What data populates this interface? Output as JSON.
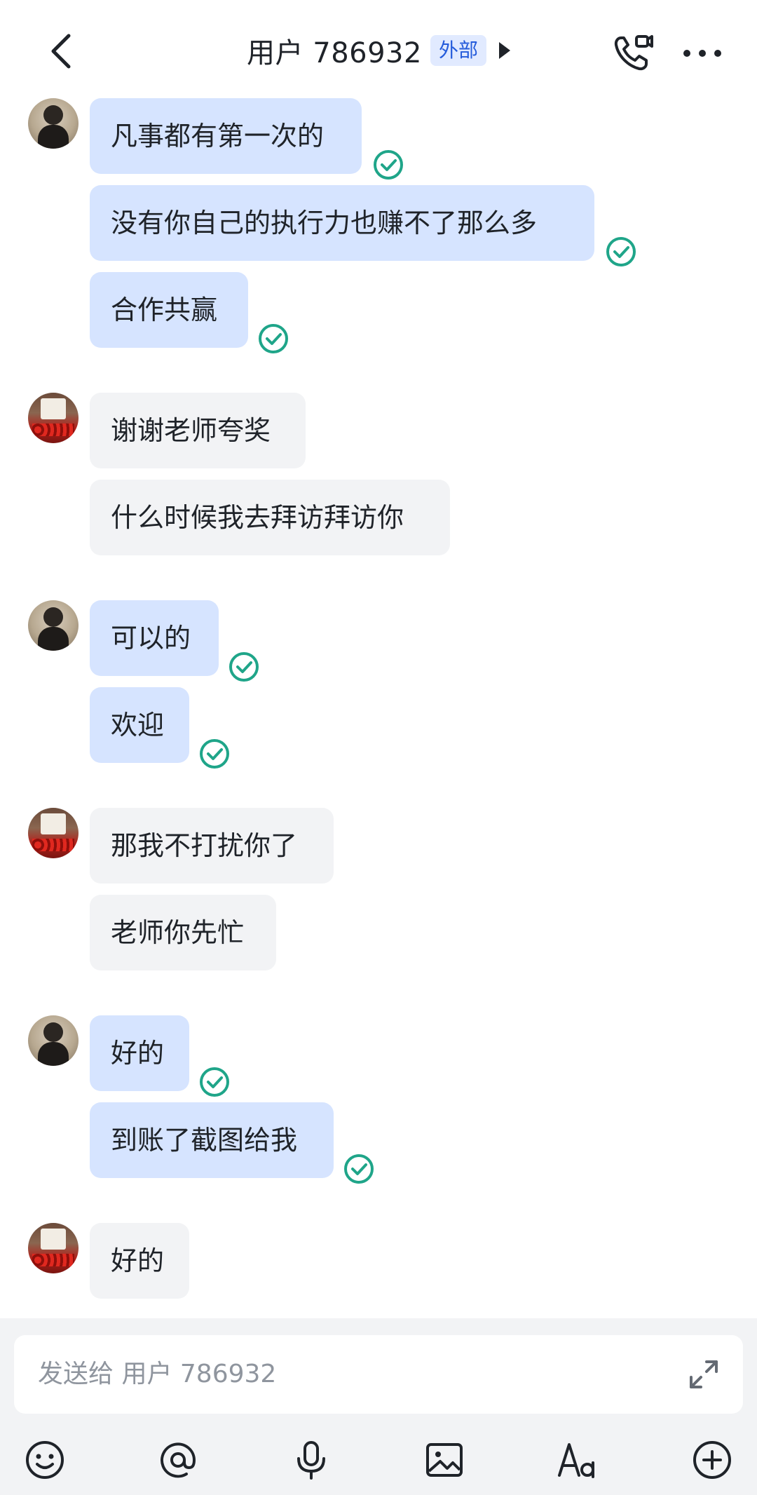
{
  "header": {
    "title": "用户 786932",
    "tag": "外部"
  },
  "colors": {
    "bubble_me": "#d6e4ff",
    "bubble_peer": "#f2f3f5",
    "read_check": "#1fa589",
    "tag_bg": "#e1eaff",
    "tag_text": "#245bdb"
  },
  "messages": [
    {
      "sender": "me",
      "text": "凡事都有第一次的",
      "read": true
    },
    {
      "sender": "me",
      "text": "没有你自己的执行力也赚不了那么多",
      "read": true
    },
    {
      "sender": "me",
      "text": "合作共赢",
      "read": true
    },
    {
      "sender": "peer",
      "text": "谢谢老师夸奖"
    },
    {
      "sender": "peer",
      "text": "什么时候我去拜访拜访你"
    },
    {
      "sender": "me",
      "text": "可以的",
      "read": true
    },
    {
      "sender": "me",
      "text": "欢迎",
      "read": true
    },
    {
      "sender": "peer",
      "text": "那我不打扰你了"
    },
    {
      "sender": "peer",
      "text": "老师你先忙"
    },
    {
      "sender": "me",
      "text": "好的",
      "read": true
    },
    {
      "sender": "me",
      "text": "到账了截图给我",
      "read": true
    },
    {
      "sender": "peer",
      "text": "好的"
    }
  ],
  "composer": {
    "placeholder": "发送给 用户 786932"
  },
  "icons": {
    "back": "chevron-left-icon",
    "call": "phone-video-icon",
    "more": "more-horizontal-icon",
    "read": "check-circle-icon",
    "expand": "expand-icon",
    "emoji": "emoji-icon",
    "mention": "at-icon",
    "voice": "microphone-icon",
    "image": "image-icon",
    "format": "text-format-icon",
    "add": "plus-circle-icon"
  }
}
